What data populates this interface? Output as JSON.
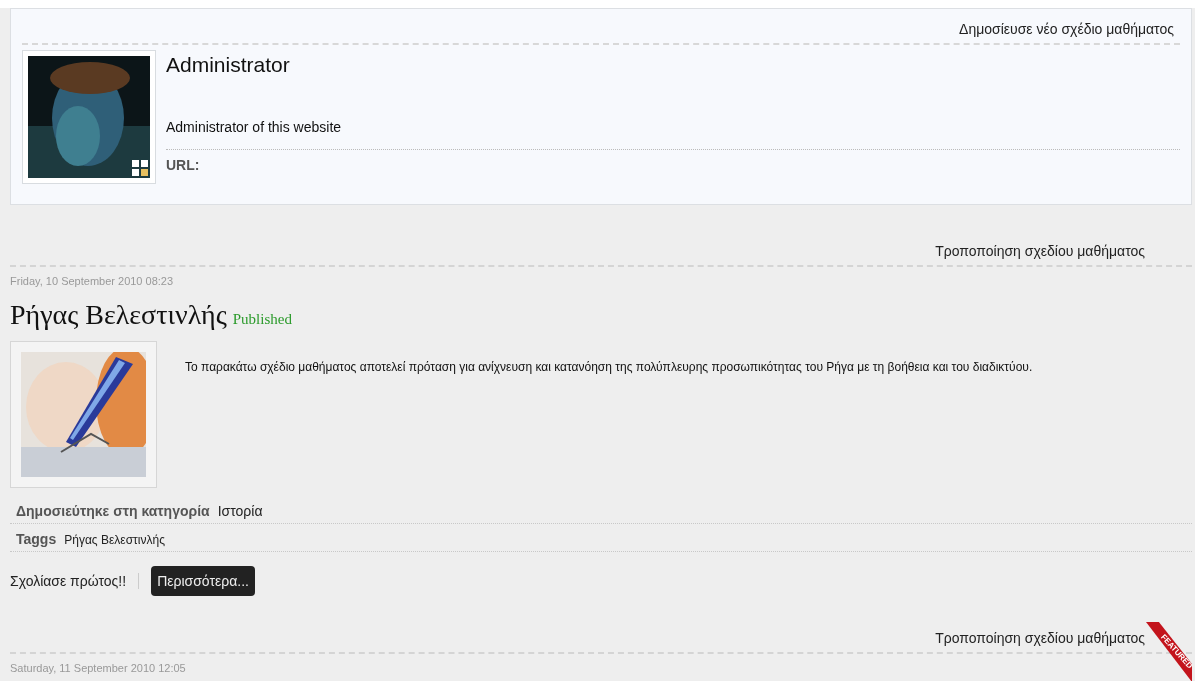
{
  "author_box": {
    "new_plan_link": "Δημοσίευσε νέο σχέδιο μαθήματος",
    "name": "Administrator",
    "description": "Administrator of this website",
    "url_label": "URL:"
  },
  "articles": [
    {
      "edit_link": "Τροποποίηση σχεδίου μαθήματος",
      "featured": false,
      "date": "Friday, 10 September 2010 08:23",
      "title": "Ρήγας Βελεστινλής",
      "status": "Published",
      "summary": "Το παρακάτω σχέδιο μαθήματος αποτελεί πρόταση για ανίχνευση και κατανόηση της πολύπλευρης προσωπικότητας του Ρήγα με τη βοήθεια και του διαδικτύου.",
      "category_label": "Δημοσιεύτηκε στη κατηγορία",
      "category": "Ιστορία",
      "tags_label": "Taggs",
      "tags": "Ρήγας Βελεστινλής",
      "comment_link": "Σχολίασε πρώτος!!",
      "more_button": "Περισσότερα..."
    },
    {
      "edit_link": "Τροποποίηση σχεδίου μαθήματος",
      "featured": true,
      "featured_label": "FEATURED",
      "date": "Saturday, 11 September 2010 12:05"
    }
  ]
}
